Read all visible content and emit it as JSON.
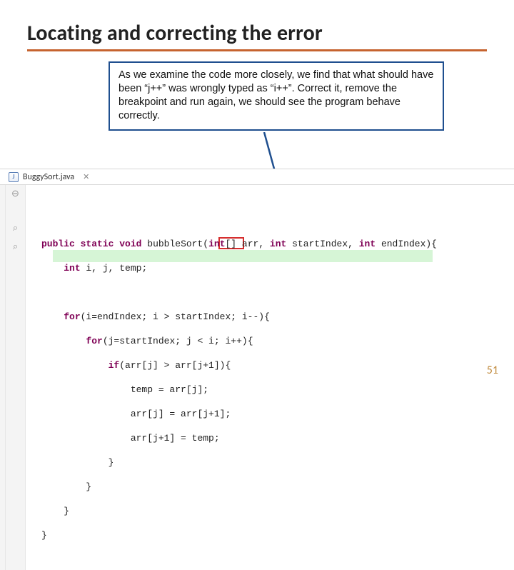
{
  "title": "Locating and correcting the error",
  "callout": "As we examine the code more closely, we find that what should have been “j++” was wrongly typed as “i++”. Correct it, remove the breakpoint and run again, we should see the program behave correctly.",
  "tab": {
    "icon_letter": "J",
    "filename": "BuggySort.java",
    "close": "✕"
  },
  "code": {
    "l1": {
      "kw1": "public",
      "kw2": "static",
      "kw3": "void",
      "sig_a": " bubbleSort(",
      "kw4": "int",
      "sig_b": "[] arr, ",
      "kw5": "int",
      "sig_c": " startIndex, ",
      "kw6": "int",
      "sig_d": " endIndex){"
    },
    "l2": {
      "kw": "int",
      "rest": " i, j, temp;"
    },
    "l4": {
      "kw": "for",
      "rest": "(i=endIndex; i > startIndex; i--){"
    },
    "l5": {
      "kw": "for",
      "rest_a": "(j=startIndex; j < i; ",
      "boxed": "i++)",
      "rest_b": "{"
    },
    "l6": {
      "kw": "if",
      "rest": "(arr[j] > arr[j+1]){"
    },
    "l7": "temp = arr[j];",
    "l8": "arr[j] = arr[j+1];",
    "l9": "arr[j+1] = temp;",
    "l10": "}",
    "l11": "}",
    "l12": "}",
    "l13": "}"
  },
  "gutter": {
    "minus": "⊖",
    "lens1": "⌕",
    "lens2": "⌕"
  },
  "page_number": "51"
}
